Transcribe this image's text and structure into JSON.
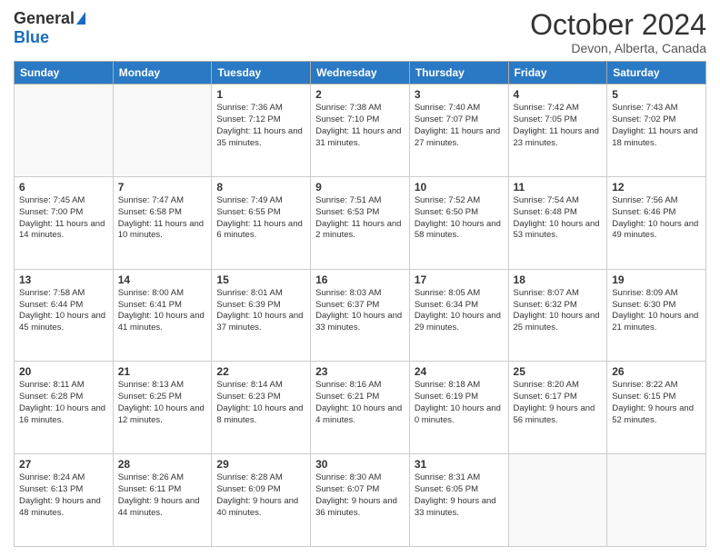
{
  "header": {
    "logo_general": "General",
    "logo_blue": "Blue",
    "month_title": "October 2024",
    "location": "Devon, Alberta, Canada"
  },
  "days_of_week": [
    "Sunday",
    "Monday",
    "Tuesday",
    "Wednesday",
    "Thursday",
    "Friday",
    "Saturday"
  ],
  "weeks": [
    [
      {
        "num": "",
        "detail": ""
      },
      {
        "num": "",
        "detail": ""
      },
      {
        "num": "1",
        "detail": "Sunrise: 7:36 AM\nSunset: 7:12 PM\nDaylight: 11 hours and 35 minutes."
      },
      {
        "num": "2",
        "detail": "Sunrise: 7:38 AM\nSunset: 7:10 PM\nDaylight: 11 hours and 31 minutes."
      },
      {
        "num": "3",
        "detail": "Sunrise: 7:40 AM\nSunset: 7:07 PM\nDaylight: 11 hours and 27 minutes."
      },
      {
        "num": "4",
        "detail": "Sunrise: 7:42 AM\nSunset: 7:05 PM\nDaylight: 11 hours and 23 minutes."
      },
      {
        "num": "5",
        "detail": "Sunrise: 7:43 AM\nSunset: 7:02 PM\nDaylight: 11 hours and 18 minutes."
      }
    ],
    [
      {
        "num": "6",
        "detail": "Sunrise: 7:45 AM\nSunset: 7:00 PM\nDaylight: 11 hours and 14 minutes."
      },
      {
        "num": "7",
        "detail": "Sunrise: 7:47 AM\nSunset: 6:58 PM\nDaylight: 11 hours and 10 minutes."
      },
      {
        "num": "8",
        "detail": "Sunrise: 7:49 AM\nSunset: 6:55 PM\nDaylight: 11 hours and 6 minutes."
      },
      {
        "num": "9",
        "detail": "Sunrise: 7:51 AM\nSunset: 6:53 PM\nDaylight: 11 hours and 2 minutes."
      },
      {
        "num": "10",
        "detail": "Sunrise: 7:52 AM\nSunset: 6:50 PM\nDaylight: 10 hours and 58 minutes."
      },
      {
        "num": "11",
        "detail": "Sunrise: 7:54 AM\nSunset: 6:48 PM\nDaylight: 10 hours and 53 minutes."
      },
      {
        "num": "12",
        "detail": "Sunrise: 7:56 AM\nSunset: 6:46 PM\nDaylight: 10 hours and 49 minutes."
      }
    ],
    [
      {
        "num": "13",
        "detail": "Sunrise: 7:58 AM\nSunset: 6:44 PM\nDaylight: 10 hours and 45 minutes."
      },
      {
        "num": "14",
        "detail": "Sunrise: 8:00 AM\nSunset: 6:41 PM\nDaylight: 10 hours and 41 minutes."
      },
      {
        "num": "15",
        "detail": "Sunrise: 8:01 AM\nSunset: 6:39 PM\nDaylight: 10 hours and 37 minutes."
      },
      {
        "num": "16",
        "detail": "Sunrise: 8:03 AM\nSunset: 6:37 PM\nDaylight: 10 hours and 33 minutes."
      },
      {
        "num": "17",
        "detail": "Sunrise: 8:05 AM\nSunset: 6:34 PM\nDaylight: 10 hours and 29 minutes."
      },
      {
        "num": "18",
        "detail": "Sunrise: 8:07 AM\nSunset: 6:32 PM\nDaylight: 10 hours and 25 minutes."
      },
      {
        "num": "19",
        "detail": "Sunrise: 8:09 AM\nSunset: 6:30 PM\nDaylight: 10 hours and 21 minutes."
      }
    ],
    [
      {
        "num": "20",
        "detail": "Sunrise: 8:11 AM\nSunset: 6:28 PM\nDaylight: 10 hours and 16 minutes."
      },
      {
        "num": "21",
        "detail": "Sunrise: 8:13 AM\nSunset: 6:25 PM\nDaylight: 10 hours and 12 minutes."
      },
      {
        "num": "22",
        "detail": "Sunrise: 8:14 AM\nSunset: 6:23 PM\nDaylight: 10 hours and 8 minutes."
      },
      {
        "num": "23",
        "detail": "Sunrise: 8:16 AM\nSunset: 6:21 PM\nDaylight: 10 hours and 4 minutes."
      },
      {
        "num": "24",
        "detail": "Sunrise: 8:18 AM\nSunset: 6:19 PM\nDaylight: 10 hours and 0 minutes."
      },
      {
        "num": "25",
        "detail": "Sunrise: 8:20 AM\nSunset: 6:17 PM\nDaylight: 9 hours and 56 minutes."
      },
      {
        "num": "26",
        "detail": "Sunrise: 8:22 AM\nSunset: 6:15 PM\nDaylight: 9 hours and 52 minutes."
      }
    ],
    [
      {
        "num": "27",
        "detail": "Sunrise: 8:24 AM\nSunset: 6:13 PM\nDaylight: 9 hours and 48 minutes."
      },
      {
        "num": "28",
        "detail": "Sunrise: 8:26 AM\nSunset: 6:11 PM\nDaylight: 9 hours and 44 minutes."
      },
      {
        "num": "29",
        "detail": "Sunrise: 8:28 AM\nSunset: 6:09 PM\nDaylight: 9 hours and 40 minutes."
      },
      {
        "num": "30",
        "detail": "Sunrise: 8:30 AM\nSunset: 6:07 PM\nDaylight: 9 hours and 36 minutes."
      },
      {
        "num": "31",
        "detail": "Sunrise: 8:31 AM\nSunset: 6:05 PM\nDaylight: 9 hours and 33 minutes."
      },
      {
        "num": "",
        "detail": ""
      },
      {
        "num": "",
        "detail": ""
      }
    ]
  ]
}
